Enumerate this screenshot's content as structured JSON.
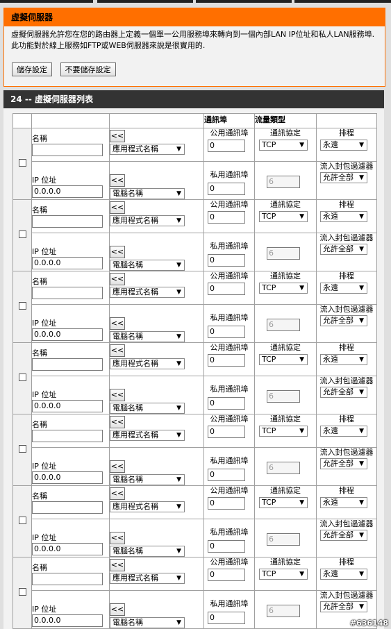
{
  "section": {
    "title": "虛擬伺服器",
    "description": "虛擬伺服器允許您在您的路由器上定義一個單一公用服務埠來轉向到一個內部LAN IP位址和私人LAN服務埠.此功能對於線上服務如FTP或WEB伺服器來說是很實用的.",
    "save_label": "儲存設定",
    "nosave_label": "不要儲存設定"
  },
  "list": {
    "title": "24 -- 虛擬伺服器列表",
    "col_port": "通訊埠",
    "col_traffic": "流量類型"
  },
  "labels": {
    "name": "名稱",
    "ip": "IP 位址",
    "arrow": "<<",
    "app_name": "應用程式名稱",
    "computer_name": "電腦名稱",
    "public_port": "公用通訊埠",
    "private_port": "私用通訊埠",
    "protocol": "通訊協定",
    "schedule": "排程",
    "filter": "流入封包過濾器"
  },
  "rules": [
    {
      "name": "",
      "ip": "0.0.0.0",
      "public_port": "0",
      "private_port": "0",
      "protocol": "TCP",
      "protocol_num": "6",
      "schedule": "永遠",
      "filter": "允許全部"
    },
    {
      "name": "",
      "ip": "0.0.0.0",
      "public_port": "0",
      "private_port": "0",
      "protocol": "TCP",
      "protocol_num": "6",
      "schedule": "永遠",
      "filter": "允許全部"
    },
    {
      "name": "",
      "ip": "0.0.0.0",
      "public_port": "0",
      "private_port": "0",
      "protocol": "TCP",
      "protocol_num": "6",
      "schedule": "永遠",
      "filter": "允許全部"
    },
    {
      "name": "",
      "ip": "0.0.0.0",
      "public_port": "0",
      "private_port": "0",
      "protocol": "TCP",
      "protocol_num": "6",
      "schedule": "永遠",
      "filter": "允許全部"
    },
    {
      "name": "",
      "ip": "0.0.0.0",
      "public_port": "0",
      "private_port": "0",
      "protocol": "TCP",
      "protocol_num": "6",
      "schedule": "永遠",
      "filter": "允許全部"
    },
    {
      "name": "",
      "ip": "0.0.0.0",
      "public_port": "0",
      "private_port": "0",
      "protocol": "TCP",
      "protocol_num": "6",
      "schedule": "永遠",
      "filter": "允許全部"
    },
    {
      "name": "",
      "ip": "0.0.0.0",
      "public_port": "0",
      "private_port": "0",
      "protocol": "TCP",
      "protocol_num": "6",
      "schedule": "永遠",
      "filter": "允許全部"
    }
  ],
  "watermark": "#636148"
}
